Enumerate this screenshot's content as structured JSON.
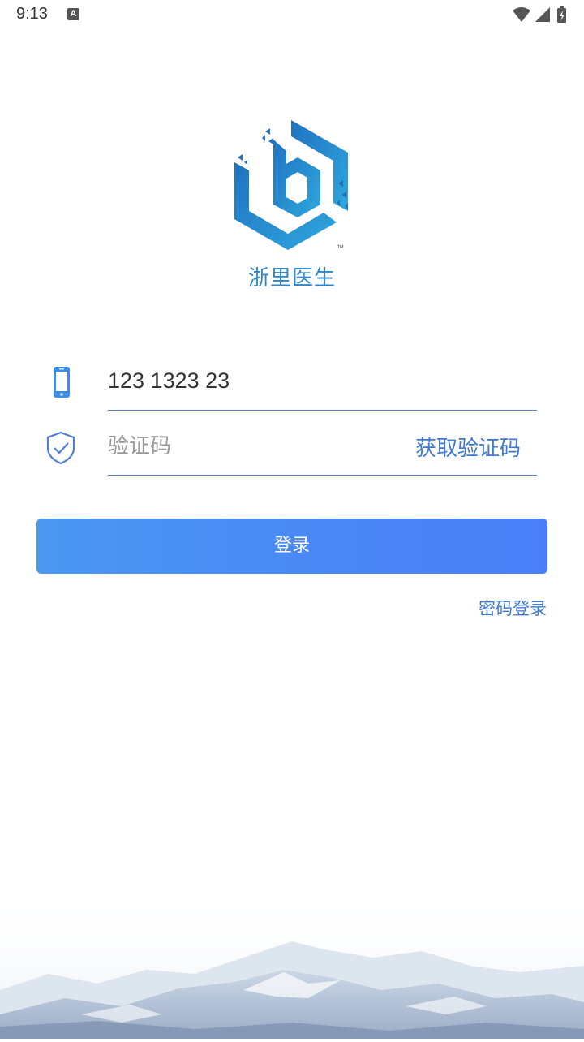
{
  "status_bar": {
    "time": "9:13",
    "notification_icon": "A",
    "icons": [
      "wifi-icon",
      "cell-signal-icon",
      "battery-icon"
    ]
  },
  "brand": {
    "name": "浙里医生",
    "trademark": "™",
    "color": "#2f86c8"
  },
  "form": {
    "phone": {
      "value": "123 1323 23",
      "icon": "mobile-phone-icon"
    },
    "code": {
      "placeholder": "验证码",
      "value": "",
      "icon": "shield-check-icon",
      "get_code_label": "获取验证码"
    }
  },
  "actions": {
    "login_label": "登录",
    "password_login_label": "密码登录"
  },
  "colors": {
    "accent": "#3d7ad6",
    "button_start": "#4b98f2",
    "button_end": "#4a7ff8"
  }
}
